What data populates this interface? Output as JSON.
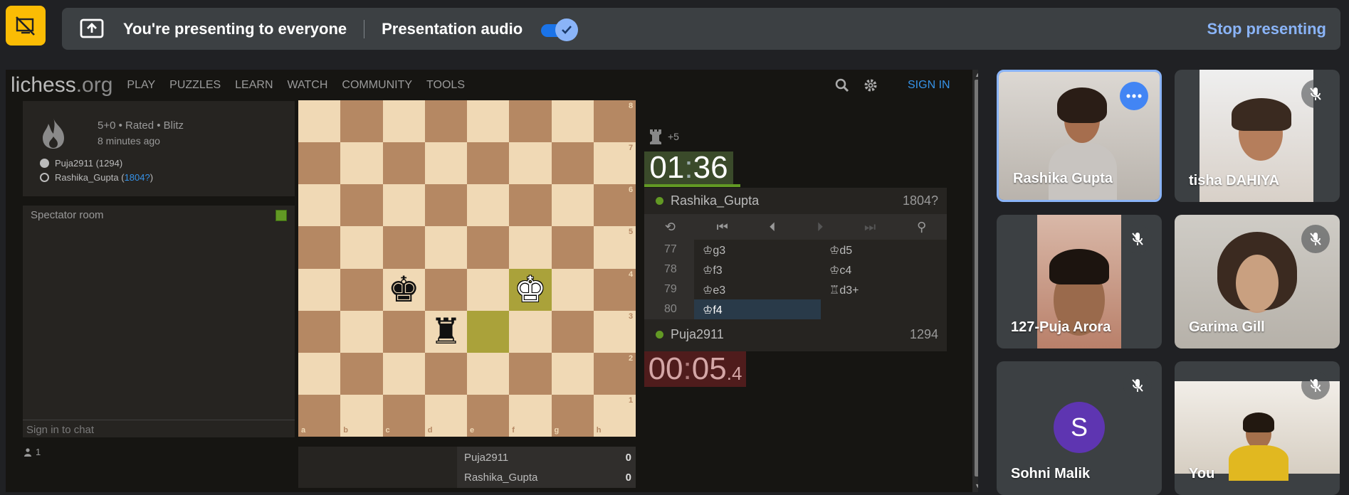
{
  "meet": {
    "presenting_text": "You're presenting to everyone",
    "audio_label": "Presentation audio",
    "audio_on": true,
    "stop_label": "Stop presenting",
    "accent_color": "#8ab4f8"
  },
  "lichess": {
    "logo_main": "lichess",
    "logo_org": ".org",
    "nav": [
      "PLAY",
      "PUZZLES",
      "LEARN",
      "WATCH",
      "COMMUNITY",
      "TOOLS"
    ],
    "sign_in": "SIGN IN",
    "game": {
      "mode": "5+0 • Rated • Blitz",
      "ago": "8 minutes ago",
      "white_name": "Puja2911 (1294)",
      "black_name": "Rashika_Gupta (",
      "black_rating": "1804?",
      "black_close": ")"
    },
    "spectator_room": "Spectator room",
    "sign_in_chat": "Sign in to chat",
    "watchers": "1",
    "board": {
      "files": [
        "a",
        "b",
        "c",
        "d",
        "e",
        "f",
        "g",
        "h"
      ],
      "ranks": [
        "8",
        "7",
        "6",
        "5",
        "4",
        "3",
        "2",
        "1"
      ],
      "highlight_squares": [
        "e3",
        "f4"
      ],
      "pieces": [
        {
          "square": "c4",
          "glyph": "♚",
          "color": "black"
        },
        {
          "square": "f4",
          "glyph": "♚",
          "color": "white"
        },
        {
          "square": "d3",
          "glyph": "♜",
          "color": "black"
        }
      ]
    },
    "score": [
      {
        "name": "Puja2911",
        "value": "0"
      },
      {
        "name": "Rashika_Gupta",
        "value": "0"
      }
    ],
    "material_diff": "+5",
    "top_clock": {
      "mm": "01",
      "ss": "36"
    },
    "bottom_clock": {
      "mm": "00",
      "ss": "05",
      "tenth": ".4"
    },
    "top_player": {
      "name": "Rashika_Gupta",
      "rating": "1804?"
    },
    "bottom_player": {
      "name": "Puja2911",
      "rating": "1294"
    },
    "moves": [
      {
        "no": "77",
        "white": "♔g3",
        "black": "♔d5"
      },
      {
        "no": "78",
        "white": "♔f3",
        "black": "♔c4"
      },
      {
        "no": "79",
        "white": "♔e3",
        "black": "♖d3+"
      },
      {
        "no": "80",
        "white": "♔f4",
        "black": ""
      }
    ]
  },
  "participants": [
    {
      "name": "Rashika Gupta",
      "muted": false,
      "active": true
    },
    {
      "name": "tisha DAHIYA",
      "muted": true
    },
    {
      "name": "127-Puja Arora",
      "muted": true
    },
    {
      "name": "Garima Gill",
      "muted": true
    },
    {
      "name": "Sohni Malik",
      "muted": true,
      "initial": "S",
      "avatar_color": "#5e35b1"
    },
    {
      "name": "You",
      "muted": true
    }
  ]
}
